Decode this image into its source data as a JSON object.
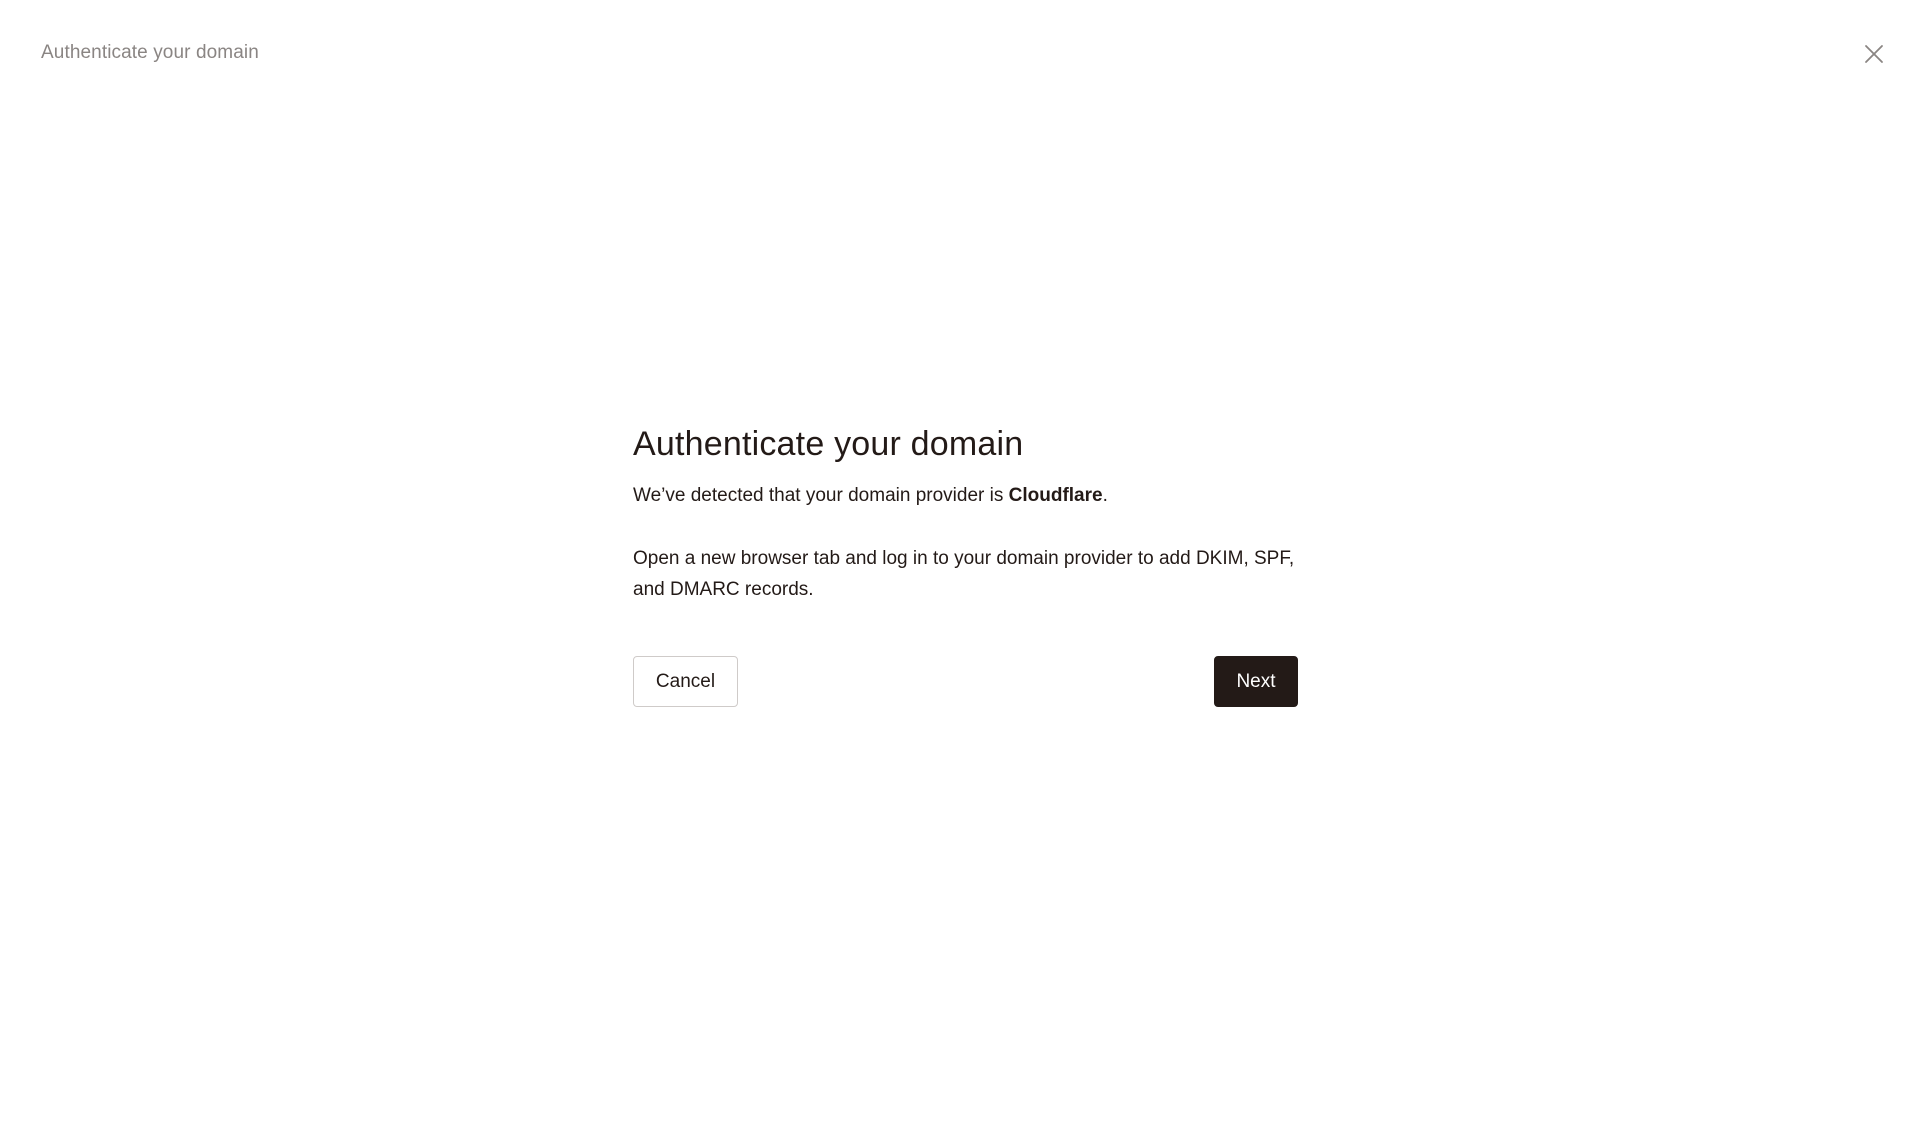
{
  "header": {
    "title": "Authenticate your domain",
    "close_icon": "close-icon"
  },
  "dialog": {
    "heading": "Authenticate your domain",
    "detect_prefix": "We’ve detected that your domain provider is ",
    "provider_name": "Cloudflare",
    "detect_suffix": ".",
    "instructions": "Open a new browser tab and log in to your domain provider to add DKIM, SPF, and DMARC records.",
    "cancel_label": "Cancel",
    "next_label": "Next"
  },
  "colors": {
    "text_primary": "#231a17",
    "text_muted": "#8a8583",
    "button_primary_bg": "#231a17",
    "button_border": "#cfcbc9",
    "background": "#ffffff"
  }
}
